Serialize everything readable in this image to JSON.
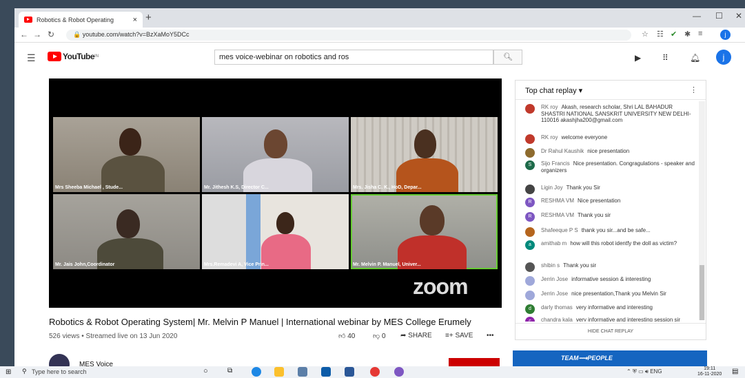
{
  "browser": {
    "tab_title": "Robotics & Robot Operating",
    "tab_close": "×",
    "new_tab": "+",
    "url": "youtube.com/watch?v=BzXaMoY5DCc",
    "minimize": "—",
    "restore": "☐",
    "close": "✕",
    "profile_initial": "j"
  },
  "youtube": {
    "logo_text": "YouTube",
    "region": "IN",
    "search_value": "mes voice-webinar on robotics and ros",
    "user_initial": "j"
  },
  "video": {
    "title": "Robotics & Robot Operating System| Mr. Melvin P Manuel | International webinar by MES College Erumely",
    "meta": "526 views • Streamed live on 13 Jun 2020",
    "likes": "40",
    "dislikes": "0",
    "share": "SHARE",
    "save": "SAVE",
    "more": "•••",
    "zoom_logo": "zoom",
    "participants": [
      {
        "name": "Mrs Sheeba Michael , Stude..."
      },
      {
        "name": "Mr. Jithesh K.S, Director C..."
      },
      {
        "name": "Mrs. Jisha C. K., HoD, Depar..."
      },
      {
        "name": "Mr. Jais John,Coordinator"
      },
      {
        "name": "Mrs.Remadevi A, Vice Prin..."
      },
      {
        "name": "Mr. Melvin P. Manuel, Univer..."
      }
    ]
  },
  "channel": {
    "name": "MES Voice"
  },
  "chat": {
    "header": "Top chat replay",
    "hide_label": "HIDE CHAT REPLAY",
    "messages": [
      {
        "author": "RK roy",
        "text": "Akash, research scholar, Shri LAL BAHADUR SHASTRI NATIONAL SANSKRIT UNIVERSITY NEW DELHI-110016 akashjha200@gmail.com",
        "avatar": "",
        "color": "#c0392b"
      },
      {
        "author": "RK roy",
        "text": "welcome everyone",
        "avatar": "",
        "color": "#c0392b"
      },
      {
        "author": "Dr Rahul Kaushik",
        "text": "nice presentation",
        "avatar": "",
        "color": "#8e6b2e"
      },
      {
        "author": "Sijo Francis",
        "text": "Nice presentation. Congragulations - speaker and organizers",
        "avatar": "S",
        "color": "#1e6b4a"
      },
      {
        "author": "Ligin Joy",
        "text": "Thank you Sir",
        "avatar": "",
        "color": "#444"
      },
      {
        "author": "RESHMA VM",
        "text": "Nice presentation",
        "avatar": "R",
        "color": "#7e57c2"
      },
      {
        "author": "RESHMA VM",
        "text": "Thank you sir",
        "avatar": "R",
        "color": "#7e57c2"
      },
      {
        "author": "Shafeeque P S",
        "text": "thank you sir...and be safe...",
        "avatar": "",
        "color": "#b5651d"
      },
      {
        "author": "amithab m",
        "text": "how will this robot identfy the doll as victim?",
        "avatar": "a",
        "color": "#00897b"
      },
      {
        "author": "shibin s",
        "text": "Thank you sir",
        "avatar": "",
        "color": "#555"
      },
      {
        "author": "Jerrin Jose",
        "text": "informative session & interesting",
        "avatar": "",
        "color": "#9fa8da"
      },
      {
        "author": "Jerrin Jose",
        "text": "nice presentation,Thank you Melvin Sir",
        "avatar": "",
        "color": "#9fa8da"
      },
      {
        "author": "darly thomas",
        "text": "very informative and interesting",
        "avatar": "d",
        "color": "#2e7d32"
      },
      {
        "author": "chandra kala",
        "text": "very informative and interesting session sir",
        "avatar": "c",
        "color": "#8e24aa"
      }
    ]
  },
  "ad": {
    "text": "TEAM⟿PEOPLE"
  },
  "taskbar": {
    "search_placeholder": "Type here to search",
    "lang": "ENG",
    "time": "19:11",
    "date": "16-11-2020"
  },
  "colors": {
    "accent": "#f00",
    "link": "#1a73e8"
  }
}
